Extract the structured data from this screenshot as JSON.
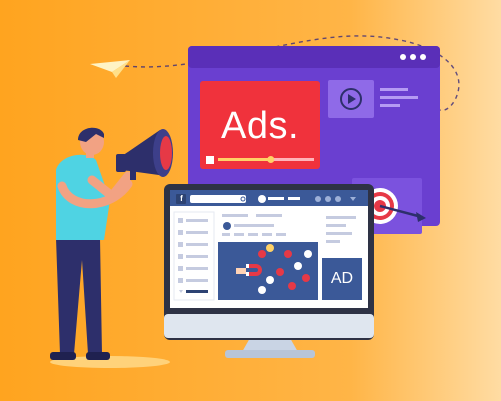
{
  "illustration": {
    "ads_banner_text": "Ads.",
    "ad_box_text": "AD",
    "social_logo_letter": "f",
    "colors": {
      "background_left": "#ffa726",
      "background_right": "#ffd89c",
      "browser_purple": "#6a3fd0",
      "browser_topbar": "#5a2fb8",
      "ads_red": "#f0323c",
      "navy": "#2d2f6b",
      "social_blue": "#3b5998",
      "shirt_cyan": "#4fd3e3",
      "target_red": "#e63946"
    },
    "progress_fraction": 0.55
  }
}
